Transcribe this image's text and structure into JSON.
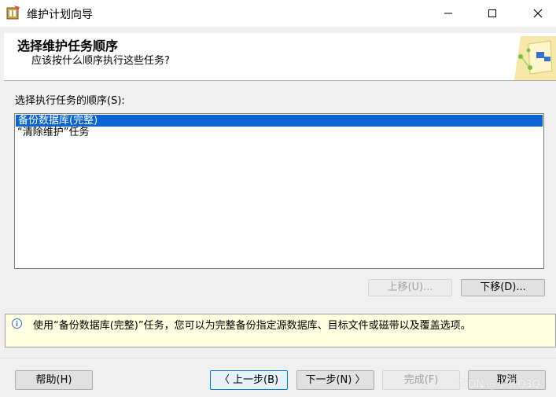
{
  "window": {
    "title": "维护计划向导",
    "icons": {
      "app": "wizard-app-icon",
      "minimize": "minimize-icon",
      "maximize": "maximize-icon",
      "close": "close-icon"
    }
  },
  "header": {
    "title": "选择维护任务顺序",
    "subtitle": "应该按什么顺序执行这些任务?",
    "graphic": "wizard-graphic-icon"
  },
  "task_order": {
    "label": "选择执行任务的顺序(S):",
    "items": [
      {
        "label": "备份数据库(完整)",
        "selected": true
      },
      {
        "label": "“清除维护”任务",
        "selected": false
      }
    ],
    "move_up_label": "上移(U)...",
    "move_down_label": "下移(D)..."
  },
  "info": {
    "icon": "info-icon",
    "text": "使用“备份数据库(完整)”任务，您可以为完整备份指定源数据库、目标文件或磁带以及覆盖选项。"
  },
  "footer": {
    "help_label": "帮助(H)",
    "back_label": "〈 上一步(B)",
    "next_label": "下一步(N) 〉",
    "finish_label": "完成(F)",
    "cancel_label": "取消"
  },
  "watermark": "CSDN @小开Q3Q",
  "colors": {
    "selection": "#0a64d6",
    "info_background": "#ffffe1",
    "dialog_background": "#f0f0f0"
  }
}
